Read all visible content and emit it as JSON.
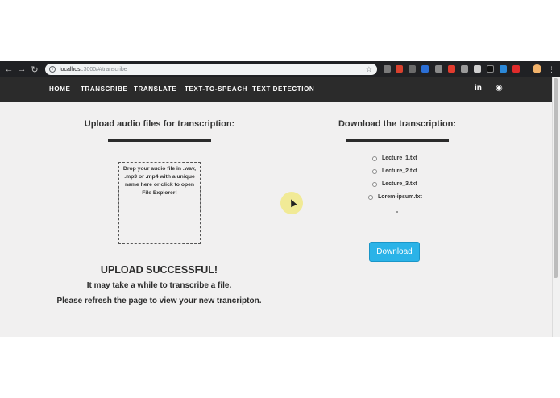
{
  "browser": {
    "url_host": "localhost",
    "url_path": ":3000/#/transcribe",
    "star_icon": "star-icon",
    "colors": {
      "chrome_bg": "#202124",
      "address_bg": "#f1f3f4"
    }
  },
  "nav": {
    "items": [
      {
        "label": "HOME"
      },
      {
        "label": "TRANSCRIBE"
      },
      {
        "label": "TRANSLATE"
      },
      {
        "label": "TEXT-TO-SPEACH"
      },
      {
        "label": "TEXT DETECTION"
      }
    ],
    "linkedin_label": "in",
    "github_label": "◉",
    "colors": {
      "bg": "#2b2b2b",
      "text": "#ffffff"
    }
  },
  "upload": {
    "heading": "Upload audio files for transcription:",
    "dropzone_text": "Drop your audio file in .wav, .mp3 or .mp4 with a unique name here or click to open File Explorer!",
    "status_title": "UPLOAD SUCCESSFUL!",
    "status_line1": "It may take a while to transcribe a file.",
    "status_line2": "Please refresh the page to view your new trancripton."
  },
  "download": {
    "heading": "Download the transcription:",
    "files": [
      {
        "label": "Lecture_1.txt"
      },
      {
        "label": "Lecture_2.txt"
      },
      {
        "label": "Lecture_3.txt"
      },
      {
        "label": "Lorem-ipsum.txt"
      }
    ],
    "button_label": "Download",
    "colors": {
      "button_bg": "#2bb3e8"
    }
  }
}
